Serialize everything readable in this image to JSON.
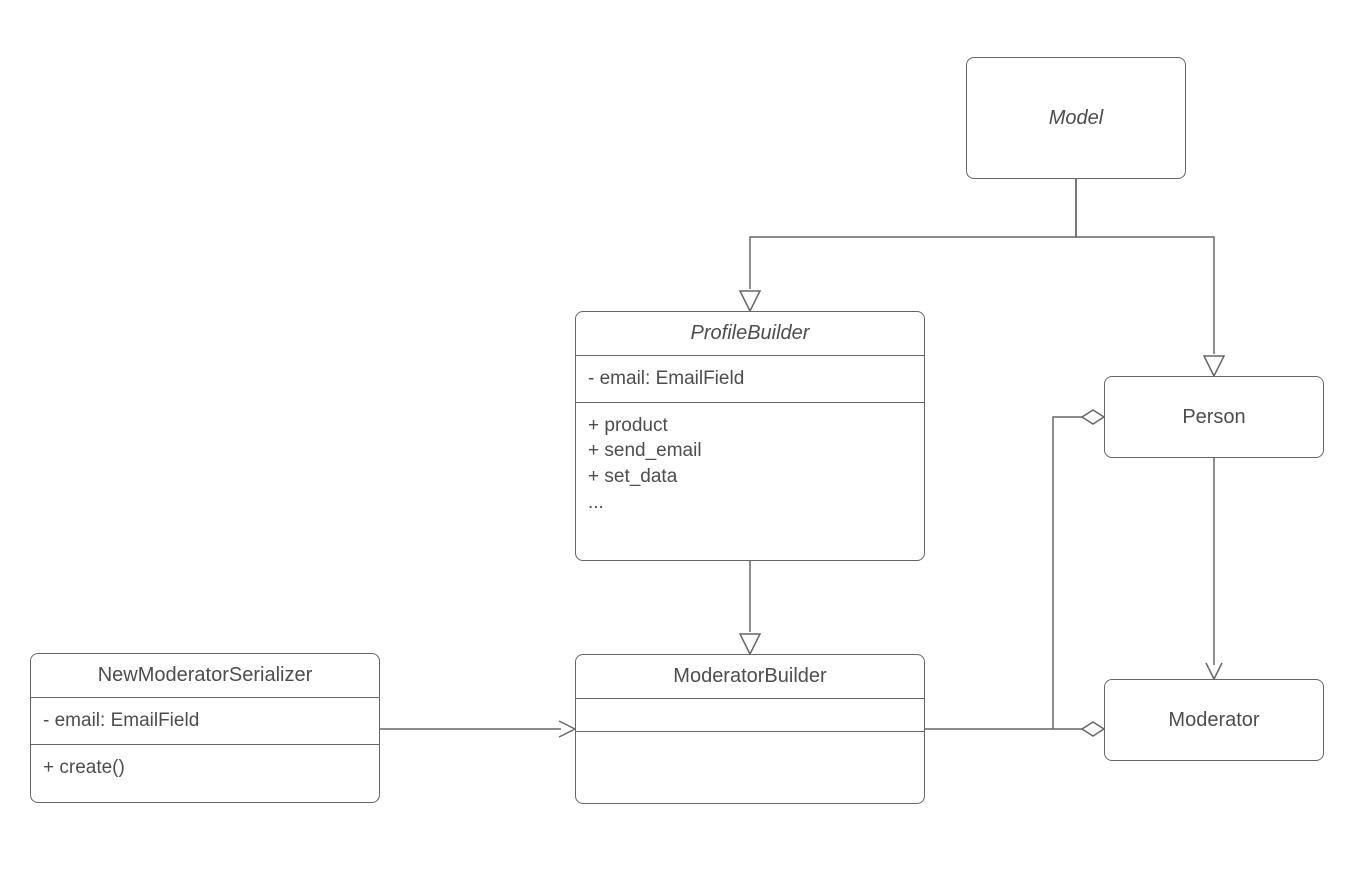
{
  "classes": {
    "model": {
      "name": "Model",
      "italic": true
    },
    "profile_builder": {
      "name": "ProfileBuilder",
      "italic": true,
      "attributes": [
        "- email: EmailField"
      ],
      "operations": [
        "+ product",
        "+  send_email",
        "+ set_data",
        "..."
      ]
    },
    "moderator_builder": {
      "name": "ModeratorBuilder",
      "italic": false,
      "attributes": [],
      "operations": []
    },
    "new_moderator_serializer": {
      "name": "NewModeratorSerializer",
      "italic": false,
      "attributes": [
        "- email: EmailField"
      ],
      "operations": [
        "+ create()"
      ]
    },
    "person": {
      "name": "Person",
      "italic": false
    },
    "moderator": {
      "name": "Moderator",
      "italic": false
    }
  },
  "relationships": [
    {
      "from": "ProfileBuilder",
      "to": "Model",
      "type": "generalization"
    },
    {
      "from": "Person",
      "to": "Model",
      "type": "generalization"
    },
    {
      "from": "ModeratorBuilder",
      "to": "ProfileBuilder",
      "type": "generalization"
    },
    {
      "from": "NewModeratorSerializer",
      "to": "ModeratorBuilder",
      "type": "association-arrow"
    },
    {
      "from": "ModeratorBuilder",
      "to": "Person",
      "type": "aggregation"
    },
    {
      "from": "ModeratorBuilder",
      "to": "Moderator",
      "type": "aggregation"
    },
    {
      "from": "Person",
      "to": "Moderator",
      "type": "association-arrow"
    }
  ],
  "colors": {
    "stroke": "#666666",
    "text": "#4d4d4d",
    "background": "#ffffff"
  },
  "legend": {
    "generalization": "hollow triangle arrowhead — inheritance / extends",
    "aggregation": "hollow diamond — has-a / aggregation",
    "association-arrow": "open arrowhead — directed association"
  }
}
